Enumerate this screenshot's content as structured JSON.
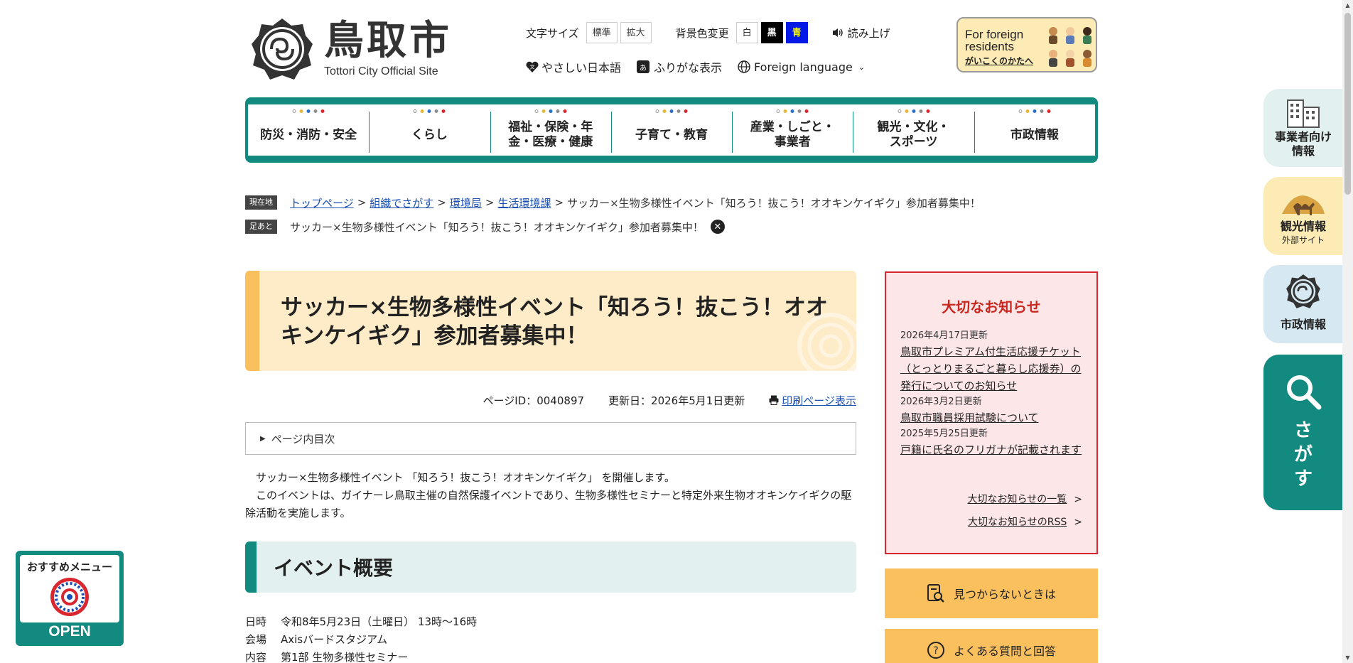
{
  "header": {
    "logo_title": "鳥取市",
    "logo_sub": "Tottori City Official Site",
    "text_size_label": "文字サイズ",
    "text_size_normal": "標準",
    "text_size_large": "拡大",
    "bg_label": "背景色変更",
    "bg_white": "白",
    "bg_black": "黒",
    "bg_blue": "青",
    "read_aloud": "読み上げ",
    "easy_japanese": "やさしい日本語",
    "furigana_icon": "あ",
    "furigana": "ふりがな表示",
    "foreign_language": "Foreign language",
    "foreign_box_line1": "For foreign",
    "foreign_box_line2": "residents",
    "foreign_box_link": "がいこくのかたへ"
  },
  "nav": [
    {
      "label": "防災・消防・安全"
    },
    {
      "label": "くらし"
    },
    {
      "label": "福祉・保険・年金・医療・健康"
    },
    {
      "label": "子育て・教育"
    },
    {
      "label": "産業・しごと・事業者"
    },
    {
      "label": "観光・文化・スポーツ"
    },
    {
      "label": "市政情報"
    }
  ],
  "nav_dot_colors": [
    "#ffffff",
    "#e8b83a",
    "#2b6fc9",
    "#8d8d8d",
    "#d9262f"
  ],
  "breadcrumb": {
    "tag_current": "現在地",
    "items": [
      "トップページ",
      "組織でさがす",
      "環境局",
      "生活環境課"
    ],
    "current": "サッカー×生物多様性イベント「知ろう！抜こう！オオキンケイギク」参加者募集中！",
    "tag_history": "足あと",
    "history_item": "サッカー×生物多様性イベント「知ろう！抜こう！オオキンケイギク」参加者募集中！"
  },
  "page": {
    "title": "サッカー×生物多様性イベント「知ろう！抜こう！オオキンケイギク」参加者募集中！",
    "page_id": "ページID：0040897",
    "updated": "更新日：2026年5月1日更新",
    "print": "印刷ページ表示",
    "toc_label": "ページ内目次",
    "intro_1": "サッカー×生物多様性イベント 「知ろう！抜こう！オオキンケイギク」 を開催します。",
    "intro_2": "このイベントは、ガイナーレ鳥取主催の自然保護イベントであり、生物多様性セミナーと特定外来生物オオキンケイギクの駆除活動を実施します。",
    "section_heading": "イベント概要",
    "details": [
      {
        "key": "日時",
        "value": "令和8年5月23日（土曜日） 13時～16時"
      },
      {
        "key": "会場",
        "value": "Axisバードスタジアム"
      },
      {
        "key": "内容",
        "value": "第1部 生物多様性セミナー"
      }
    ]
  },
  "notice": {
    "heading": "大切なお知らせ",
    "items": [
      {
        "date": "2026年4月17日更新",
        "text": "鳥取市プレミアム付生活応援チケット（とっとりまるごと暮らし応援券）の発行についてのお知らせ"
      },
      {
        "date": "2026年3月2日更新",
        "text": "鳥取市職員採用試験について"
      },
      {
        "date": "2025年5月25日更新",
        "text": "戸籍に氏名のフリガナが記載されます"
      }
    ],
    "list_link": "大切なお知らせの一覧",
    "rss_link": "大切なお知らせのRSS"
  },
  "side_buttons": {
    "not_found": "見つからないときは",
    "faq": "よくある質問と回答"
  },
  "rail": {
    "business": "事業者向け情報",
    "tourism": "観光情報",
    "tourism_sub": "外部サイト",
    "city": "市政情報",
    "search": "さがす"
  },
  "recommend": {
    "label": "おすすめメニュー",
    "open": "OPEN"
  },
  "colors": {
    "accent_teal": "#128a80",
    "title_orange": "#fbc05e",
    "notice_red": "#d9262f"
  }
}
